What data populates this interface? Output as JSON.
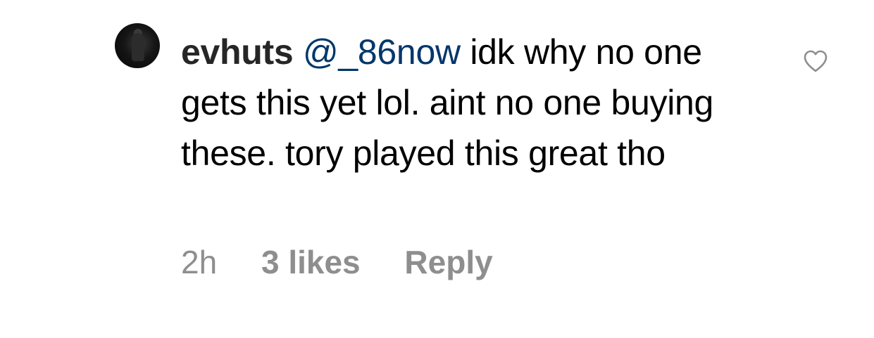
{
  "comment": {
    "username": "evhuts",
    "mention": "@_86now",
    "text": "idk why no one gets this yet lol. aint no one buying these. tory played this great tho",
    "timestamp": "2h",
    "likes": "3 likes",
    "reply_label": "Reply"
  },
  "icons": {
    "like": "heart-outline-icon",
    "avatar": "user-avatar"
  },
  "colors": {
    "username": "#262626",
    "mention": "#00376b",
    "meta": "#8e8e8e",
    "heart_stroke": "#8e8e8e"
  }
}
